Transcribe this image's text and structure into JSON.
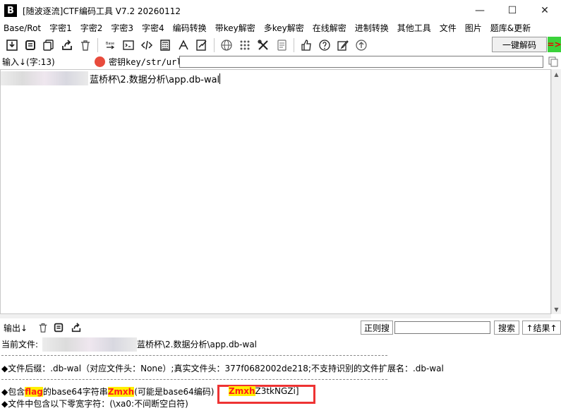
{
  "window": {
    "title": "[随波逐流]CTF编码工具 V7.2  20260112",
    "app_icon_glyph": "B",
    "minimize_glyph": "—",
    "maximize_glyph": "☐",
    "close_glyph": "✕"
  },
  "menu": [
    "Base/Rot",
    "字密1",
    "字密2",
    "字密3",
    "字密4",
    "编码转换",
    "带key解密",
    "多key解密",
    "在线解密",
    "进制转换",
    "其他工具",
    "文件",
    "图片",
    "题库&更新"
  ],
  "toolbar": {
    "icons": [
      "save-icon",
      "copy-icon",
      "duplicate-icon",
      "share-icon",
      "trash-icon",
      "base-icon",
      "terminal-icon",
      "code-icon",
      "calculator-icon",
      "font-icon",
      "sign-icon",
      "globe-icon",
      "grid-icon",
      "tools-icon",
      "script-icon",
      "thumbs-up-icon",
      "help-icon",
      "edit-icon",
      "upload-icon"
    ],
    "base_icon_text": "Base",
    "decode_button": "一键解码",
    "arrow_tab": "=>"
  },
  "input": {
    "label": "输入↓(字:13)",
    "key_label": "密钥key/str/url:",
    "key_value": "",
    "text": "蓝桥杯\\2.数据分析\\app.db-wal"
  },
  "output": {
    "label": "输出↓",
    "regex_button": "正则搜",
    "search_value": "",
    "search_button": "搜索",
    "result_button": "↑结果↑",
    "line_current_file_prefix": "当前文件:",
    "line_current_file_path": "蓝桥杯\\2.数据分析\\app.db-wal",
    "line_suffix": "◆文件后缀：.db-wal（对应文件头：None）;真实文件头：377f0682002de218;不支持识别的文件扩展名：.db-wal",
    "line_b64_pre": "◆包含",
    "line_b64_flag": "flag",
    "line_b64_mid": "的base64字符串",
    "line_b64_zmxh": "Zmxh",
    "line_b64_post": "(可能是base64编码)",
    "line_b64_result_hl": "Zmxh",
    "line_b64_result_rest": "Z3tkNGZi]",
    "line_zero_width": "◆文件中包含以下零宽字符：(\\xa0:不间断空白符)"
  },
  "colors": {
    "highlight_bg": "#ffef00",
    "highlight_fg": "#ff1a1a",
    "annotation_box": "#e33333",
    "arrow_tab_bg": "#3bd23b"
  }
}
